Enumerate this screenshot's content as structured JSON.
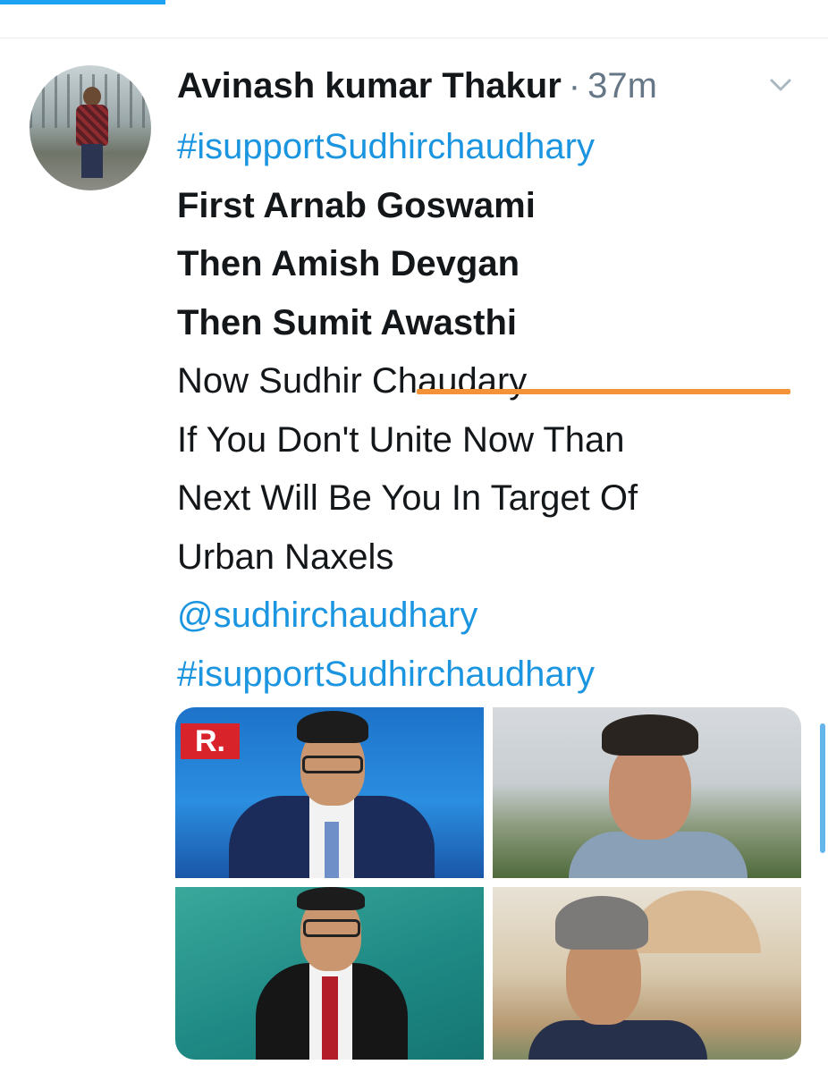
{
  "tweet": {
    "author_name": "Avinash kumar Thakur",
    "separator": "·",
    "timestamp": "37m",
    "lines": [
      {
        "text": "#isupportSudhirchaudhary",
        "style": "link"
      },
      {
        "text": "First Arnab Goswami",
        "style": "bold"
      },
      {
        "text": "Then Amish Devgan",
        "style": "bold"
      },
      {
        "text": "Then Sumit Awasthi",
        "style": "bold"
      },
      {
        "text": "Now Sudhir Chaudary",
        "style": "normal"
      },
      {
        "text": "If You Don't Unite Now Than",
        "style": "normal"
      },
      {
        "text": "Next Will Be You In Target Of",
        "style": "normal"
      },
      {
        "text": "Urban Naxels",
        "style": "normal"
      },
      {
        "text": "@sudhirchaudhary",
        "style": "link"
      },
      {
        "text": "#isupportSudhirchaudhary",
        "style": "link"
      }
    ],
    "media_logo_text": "R."
  },
  "icons": {
    "caret": "chevron-down-icon"
  },
  "colors": {
    "link": "#1b95e0",
    "muted": "#657786",
    "highlight_underline": "#f39236",
    "accent": "#1da1f2"
  }
}
